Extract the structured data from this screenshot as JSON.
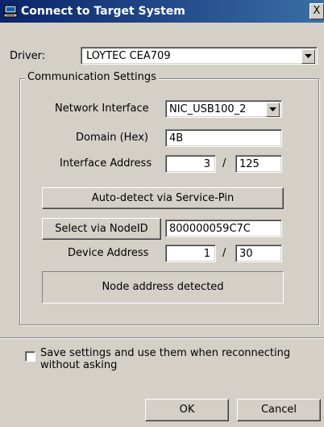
{
  "window": {
    "title": "Connect to Target System",
    "close_glyph": "X"
  },
  "driver": {
    "label": "Driver:",
    "value": "LOYTEC CEA709"
  },
  "group": {
    "legend": "Communication Settings"
  },
  "network_interface": {
    "label": "Network Interface",
    "value": "NIC_USB100_2"
  },
  "domain": {
    "label": "Domain (Hex)",
    "value": "4B"
  },
  "interface_address": {
    "label": "Interface Address",
    "subnet": "3",
    "separator": "/",
    "node": "125"
  },
  "auto_detect": {
    "label": "Auto-detect via Service-Pin"
  },
  "select_node": {
    "label": "Select via NodeID",
    "node_id": "800000059C7C"
  },
  "device_address": {
    "label": "Device Address",
    "subnet": "1",
    "separator": "/",
    "node": "30"
  },
  "status": {
    "text": "Node address detected"
  },
  "save_settings": {
    "label": "Save settings and use them when reconnecting without asking",
    "checked": false
  },
  "buttons": {
    "ok": "OK",
    "cancel": "Cancel"
  }
}
